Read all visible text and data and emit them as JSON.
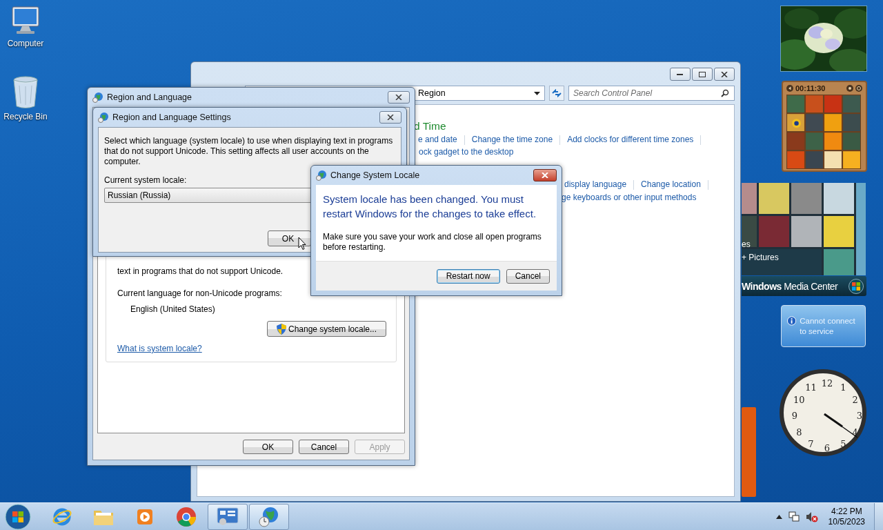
{
  "desktop_icons": [
    {
      "kind": "computer",
      "label": "Computer"
    },
    {
      "kind": "recycle",
      "label": "Recycle Bin"
    }
  ],
  "control_panel": {
    "address": "Region",
    "search": {
      "placeholder": "Search Control Panel"
    },
    "heading": "d Time",
    "links_row_1": [
      "e and date",
      "Change the time zone",
      "Add clocks for different time zones"
    ],
    "link_row_2": "ock gadget to the desktop",
    "links_row_3": [
      "display language",
      "Change location"
    ],
    "link_row_4": "ge keyboards or other input methods"
  },
  "region_dialog": {
    "title": "Region and Language",
    "partial_text": "text in programs that do not support Unicode.",
    "current_language_label": "Current language for non-Unicode programs:",
    "current_language": "English (United States)",
    "change_button": "Change system locale...",
    "help_link": "What is system locale?",
    "buttons": [
      {
        "label": "OK",
        "disabled": false
      },
      {
        "label": "Cancel",
        "disabled": false
      },
      {
        "label": "Apply",
        "disabled": true
      }
    ]
  },
  "settings_dialog": {
    "title": "Region and Language Settings",
    "description": "Select which language (system locale) to use when displaying text in programs that do not support Unicode. This setting affects all user accounts on the computer.",
    "locale_label": "Current system locale:",
    "locale_value": "Russian (Russia)",
    "ok_button": "OK"
  },
  "locale_dialog": {
    "title": "Change System Locale",
    "headline": "System locale has been changed. You must restart Windows for the changes to take effect.",
    "body": "Make sure you save your work and close all open programs before restarting.",
    "buttons": [
      {
        "label": "Restart now",
        "default": true
      },
      {
        "label": "Cancel",
        "default": false
      }
    ]
  },
  "gadgets": {
    "puzzle_timer": "00:11:30",
    "media_center": {
      "lines": [
        "es",
        "+ Pictures"
      ],
      "brand": "**Windows** Media Center"
    },
    "weather_message": "Cannot connect to service",
    "clock_numerals": [
      "12",
      "1",
      "2",
      "3",
      "4",
      "5",
      "6",
      "7",
      "8",
      "9",
      "10",
      "11"
    ]
  },
  "taskbar": {
    "apps": [
      {
        "kind": "ie",
        "active": false
      },
      {
        "kind": "explorer",
        "active": false
      },
      {
        "kind": "media",
        "active": false
      },
      {
        "kind": "chrome",
        "active": false
      },
      {
        "kind": "control",
        "active": true
      },
      {
        "kind": "region",
        "active": true
      }
    ],
    "time": "4:22 PM",
    "date": "10/5/2023"
  }
}
